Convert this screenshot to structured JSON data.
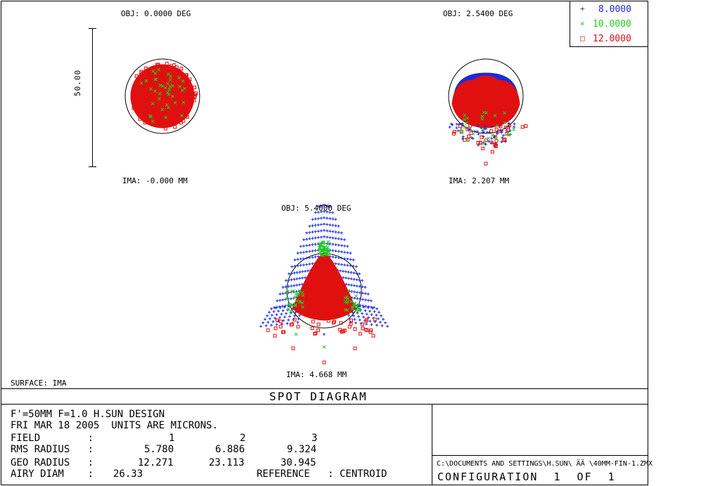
{
  "header": {
    "title": "SPOT DIAGRAM",
    "surface": "SURFACE: IMA"
  },
  "legend": [
    {
      "marker": "+",
      "label": "8.0000",
      "color": "#1a2bd6"
    },
    {
      "marker": "×",
      "label": "10.0000",
      "color": "#22cc22"
    },
    {
      "marker": "□",
      "label": "12.0000",
      "color": "#e01010"
    }
  ],
  "scale_bar": {
    "label": "50.00"
  },
  "chart_data": {
    "type": "scatter",
    "title": "SPOT DIAGRAM",
    "scale_bar_microns": 50.0,
    "series_names": [
      "8.0000",
      "10.0000",
      "12.0000"
    ],
    "fields": [
      {
        "obj_label": "OBJ: 0.0000 DEG",
        "ima_label": "IMA: -0.000 MM",
        "field_deg": 0.0,
        "ima_mm": -0.0,
        "rms_radius": 5.78,
        "geo_radius": 12.271
      },
      {
        "obj_label": "OBJ: 2.5400 DEG",
        "ima_label": "IMA: 2.207 MM",
        "field_deg": 2.54,
        "ima_mm": 2.207,
        "rms_radius": 6.886,
        "geo_radius": 23.113
      },
      {
        "obj_label": "OBJ: 5.4000 DEG",
        "ima_label": "IMA: 4.668 MM",
        "field_deg": 5.4,
        "ima_mm": 4.668,
        "rms_radius": 9.324,
        "geo_radius": 30.945
      }
    ],
    "airy_diam": 26.33
  },
  "info": {
    "line1": "F'=50MM F=1.0 H.SUN DESIGN",
    "line2": "FRI MAR 18 2005  UNITS ARE MICRONS.",
    "field_label": "FIELD        :",
    "field_values": [
      "1",
      "2",
      "3"
    ],
    "rms_label": "RMS RADIUS   :",
    "rms_values": [
      "5.780",
      "6.886",
      "9.324"
    ],
    "geo_label": "GEO RADIUS   :",
    "geo_values": [
      "12.271",
      "23.113",
      "30.945"
    ],
    "airy_label": "AIRY DIAM    :",
    "airy_value": "26.33",
    "reference": "REFERENCE   : CENTROID"
  },
  "footer": {
    "path": "C:\\DOCUMENTS AND SETTINGS\\H.SUN\\ ÄÄ \\40MM-FIN-1.ZMX",
    "configuration": "CONFIGURATION  1  OF  1"
  }
}
